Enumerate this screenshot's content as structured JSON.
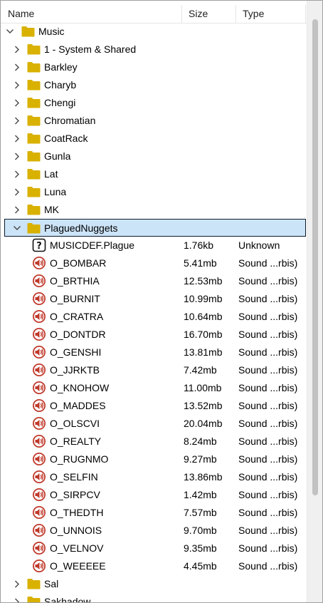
{
  "columns": {
    "name": "Name",
    "size": "Size",
    "type": "Type"
  },
  "colors": {
    "folder": "#d9b100",
    "selection": "#cce4f7",
    "sound_icon": "#c0392b"
  },
  "tree": {
    "root": {
      "label": "Music",
      "expanded": true
    },
    "folders_before": [
      "1 - System & Shared",
      "Barkley",
      "Charyb",
      "Chengi",
      "Chromatian",
      "CoatRack",
      "Gunla",
      "Lat",
      "Luna",
      "MK"
    ],
    "selected_folder": {
      "label": "PlaguedNuggets",
      "expanded": true
    },
    "files": [
      {
        "name": "MUSICDEF.Plague",
        "size": "1.76kb",
        "type": "Unknown",
        "icon": "question-icon"
      },
      {
        "name": "O_BOMBAR",
        "size": "5.41mb",
        "type": "Sound ...rbis)",
        "icon": "sound-icon"
      },
      {
        "name": "O_BRTHIA",
        "size": "12.53mb",
        "type": "Sound ...rbis)",
        "icon": "sound-icon"
      },
      {
        "name": "O_BURNIT",
        "size": "10.99mb",
        "type": "Sound ...rbis)",
        "icon": "sound-icon"
      },
      {
        "name": "O_CRATRA",
        "size": "10.64mb",
        "type": "Sound ...rbis)",
        "icon": "sound-icon"
      },
      {
        "name": "O_DONTDR",
        "size": "16.70mb",
        "type": "Sound ...rbis)",
        "icon": "sound-icon"
      },
      {
        "name": "O_GENSHI",
        "size": "13.81mb",
        "type": "Sound ...rbis)",
        "icon": "sound-icon"
      },
      {
        "name": "O_JJRKTB",
        "size": "7.42mb",
        "type": "Sound ...rbis)",
        "icon": "sound-icon"
      },
      {
        "name": "O_KNOHOW",
        "size": "11.00mb",
        "type": "Sound ...rbis)",
        "icon": "sound-icon"
      },
      {
        "name": "O_MADDES",
        "size": "13.52mb",
        "type": "Sound ...rbis)",
        "icon": "sound-icon"
      },
      {
        "name": "O_OLSCVI",
        "size": "20.04mb",
        "type": "Sound ...rbis)",
        "icon": "sound-icon"
      },
      {
        "name": "O_REALTY",
        "size": "8.24mb",
        "type": "Sound ...rbis)",
        "icon": "sound-icon"
      },
      {
        "name": "O_RUGNMO",
        "size": "9.27mb",
        "type": "Sound ...rbis)",
        "icon": "sound-icon"
      },
      {
        "name": "O_SELFIN",
        "size": "13.86mb",
        "type": "Sound ...rbis)",
        "icon": "sound-icon"
      },
      {
        "name": "O_SIRPCV",
        "size": "1.42mb",
        "type": "Sound ...rbis)",
        "icon": "sound-icon"
      },
      {
        "name": "O_THEDTH",
        "size": "7.57mb",
        "type": "Sound ...rbis)",
        "icon": "sound-icon"
      },
      {
        "name": "O_UNNOIS",
        "size": "9.70mb",
        "type": "Sound ...rbis)",
        "icon": "sound-icon"
      },
      {
        "name": "O_VELNOV",
        "size": "9.35mb",
        "type": "Sound ...rbis)",
        "icon": "sound-icon"
      },
      {
        "name": "O_WEEEEE",
        "size": "4.45mb",
        "type": "Sound ...rbis)",
        "icon": "sound-icon"
      }
    ],
    "folders_after": [
      "Sal",
      "Sakhadow"
    ]
  }
}
